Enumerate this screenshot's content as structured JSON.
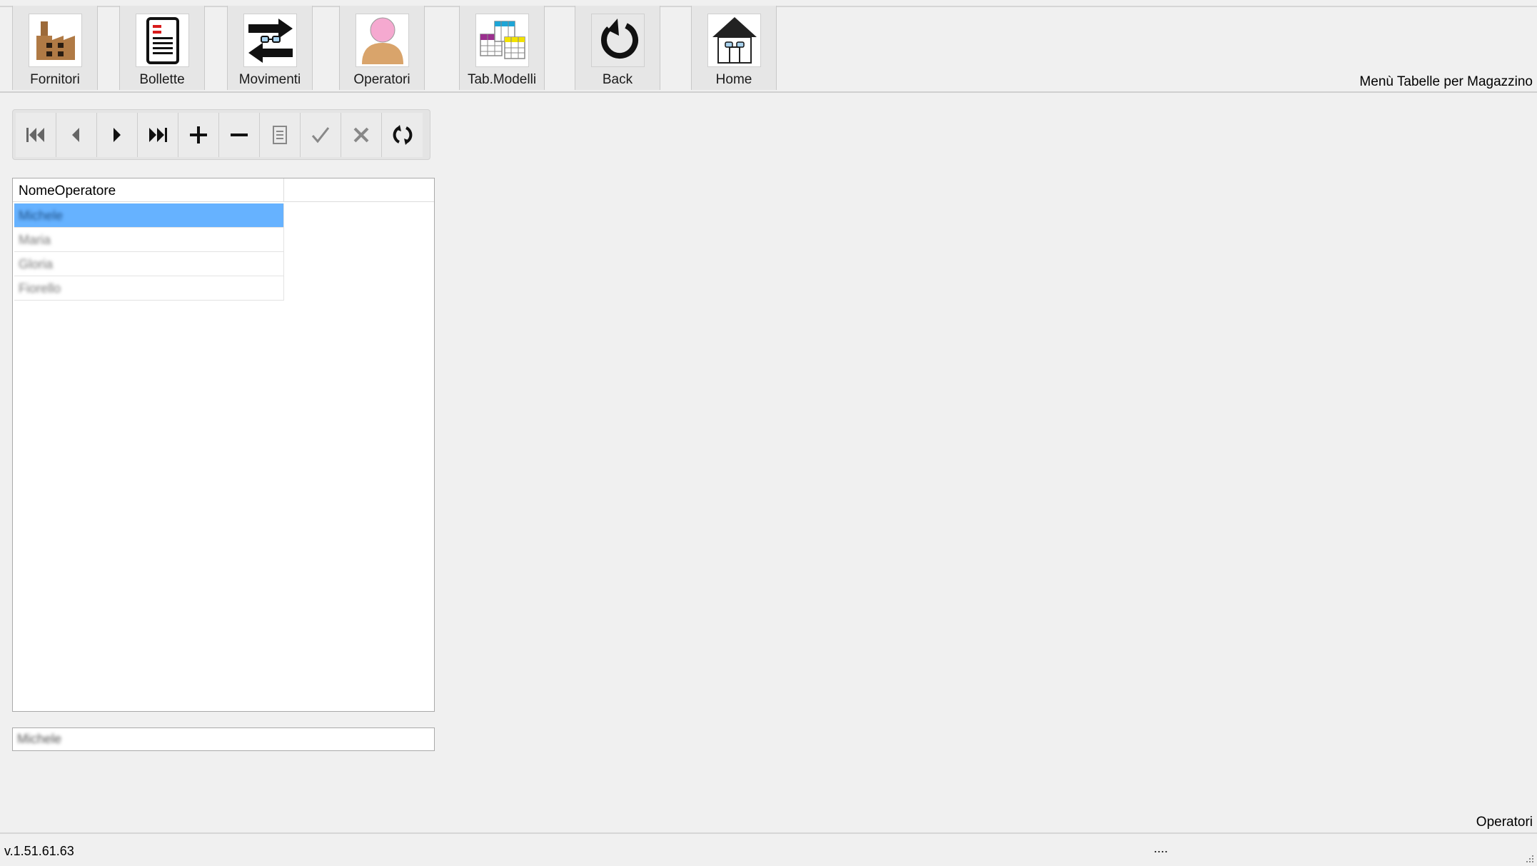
{
  "toolbar": {
    "buttons": [
      {
        "label": "Fornitori",
        "icon": "factory-icon"
      },
      {
        "label": "Bollette",
        "icon": "document-icon"
      },
      {
        "label": "Movimenti",
        "icon": "transfer-arrows-icon"
      },
      {
        "label": "Operatori",
        "icon": "person-icon"
      },
      {
        "label": "Tab.Modelli",
        "icon": "tables-icon"
      },
      {
        "label": "Back",
        "icon": "back-arrow-icon"
      },
      {
        "label": "Home",
        "icon": "home-icon"
      }
    ],
    "menu_title": "Menù Tabelle per Magazzino"
  },
  "navigator": {
    "buttons": [
      "first-record-icon",
      "previous-record-icon",
      "next-record-icon",
      "last-record-icon",
      "add-icon",
      "delete-icon",
      "edit-icon",
      "confirm-icon",
      "cancel-icon",
      "refresh-icon"
    ]
  },
  "grid": {
    "column_header": "NomeOperatore",
    "rows": [
      "Michele",
      "Maria",
      "Gloria",
      "Fiorello"
    ],
    "selected_index": 0
  },
  "detail": {
    "value": "Michele"
  },
  "form_name": "Operatori",
  "status": {
    "version": "v.1.51.61.63",
    "indicator": "...."
  },
  "colors": {
    "selection": "#66b2ff",
    "background": "#f0f0f0"
  }
}
